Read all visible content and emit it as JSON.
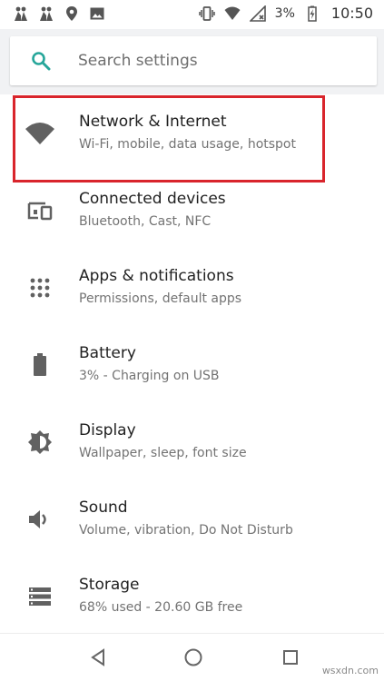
{
  "status_bar": {
    "left_icons": [
      "person-icon",
      "person-icon",
      "location-icon",
      "image-icon"
    ],
    "right_icons": [
      "vibrate-icon",
      "wifi-icon",
      "no-signal-icon"
    ],
    "battery_percent": "3%",
    "time": "10:50"
  },
  "search": {
    "placeholder": "Search settings"
  },
  "settings": {
    "items": [
      {
        "title": "Network & Internet",
        "subtitle": "Wi-Fi, mobile, data usage, hotspot",
        "icon": "wifi-icon"
      },
      {
        "title": "Connected devices",
        "subtitle": "Bluetooth, Cast, NFC",
        "icon": "devices-icon"
      },
      {
        "title": "Apps & notifications",
        "subtitle": "Permissions, default apps",
        "icon": "apps-grid-icon"
      },
      {
        "title": "Battery",
        "subtitle": "3% - Charging on USB",
        "icon": "battery-icon"
      },
      {
        "title": "Display",
        "subtitle": "Wallpaper, sleep, font size",
        "icon": "brightness-icon"
      },
      {
        "title": "Sound",
        "subtitle": "Volume, vibration, Do Not Disturb",
        "icon": "volume-icon"
      },
      {
        "title": "Storage",
        "subtitle": "68% used - 20.60 GB free",
        "icon": "storage-icon"
      }
    ]
  },
  "nav_bar": {
    "buttons": [
      "back-icon",
      "home-icon",
      "recents-icon"
    ]
  },
  "watermark": "wsxdn.com",
  "colors": {
    "accent": "#26a69a",
    "highlight": "#d9252c",
    "icon": "#616161",
    "search_background": "#f1f2f4"
  }
}
